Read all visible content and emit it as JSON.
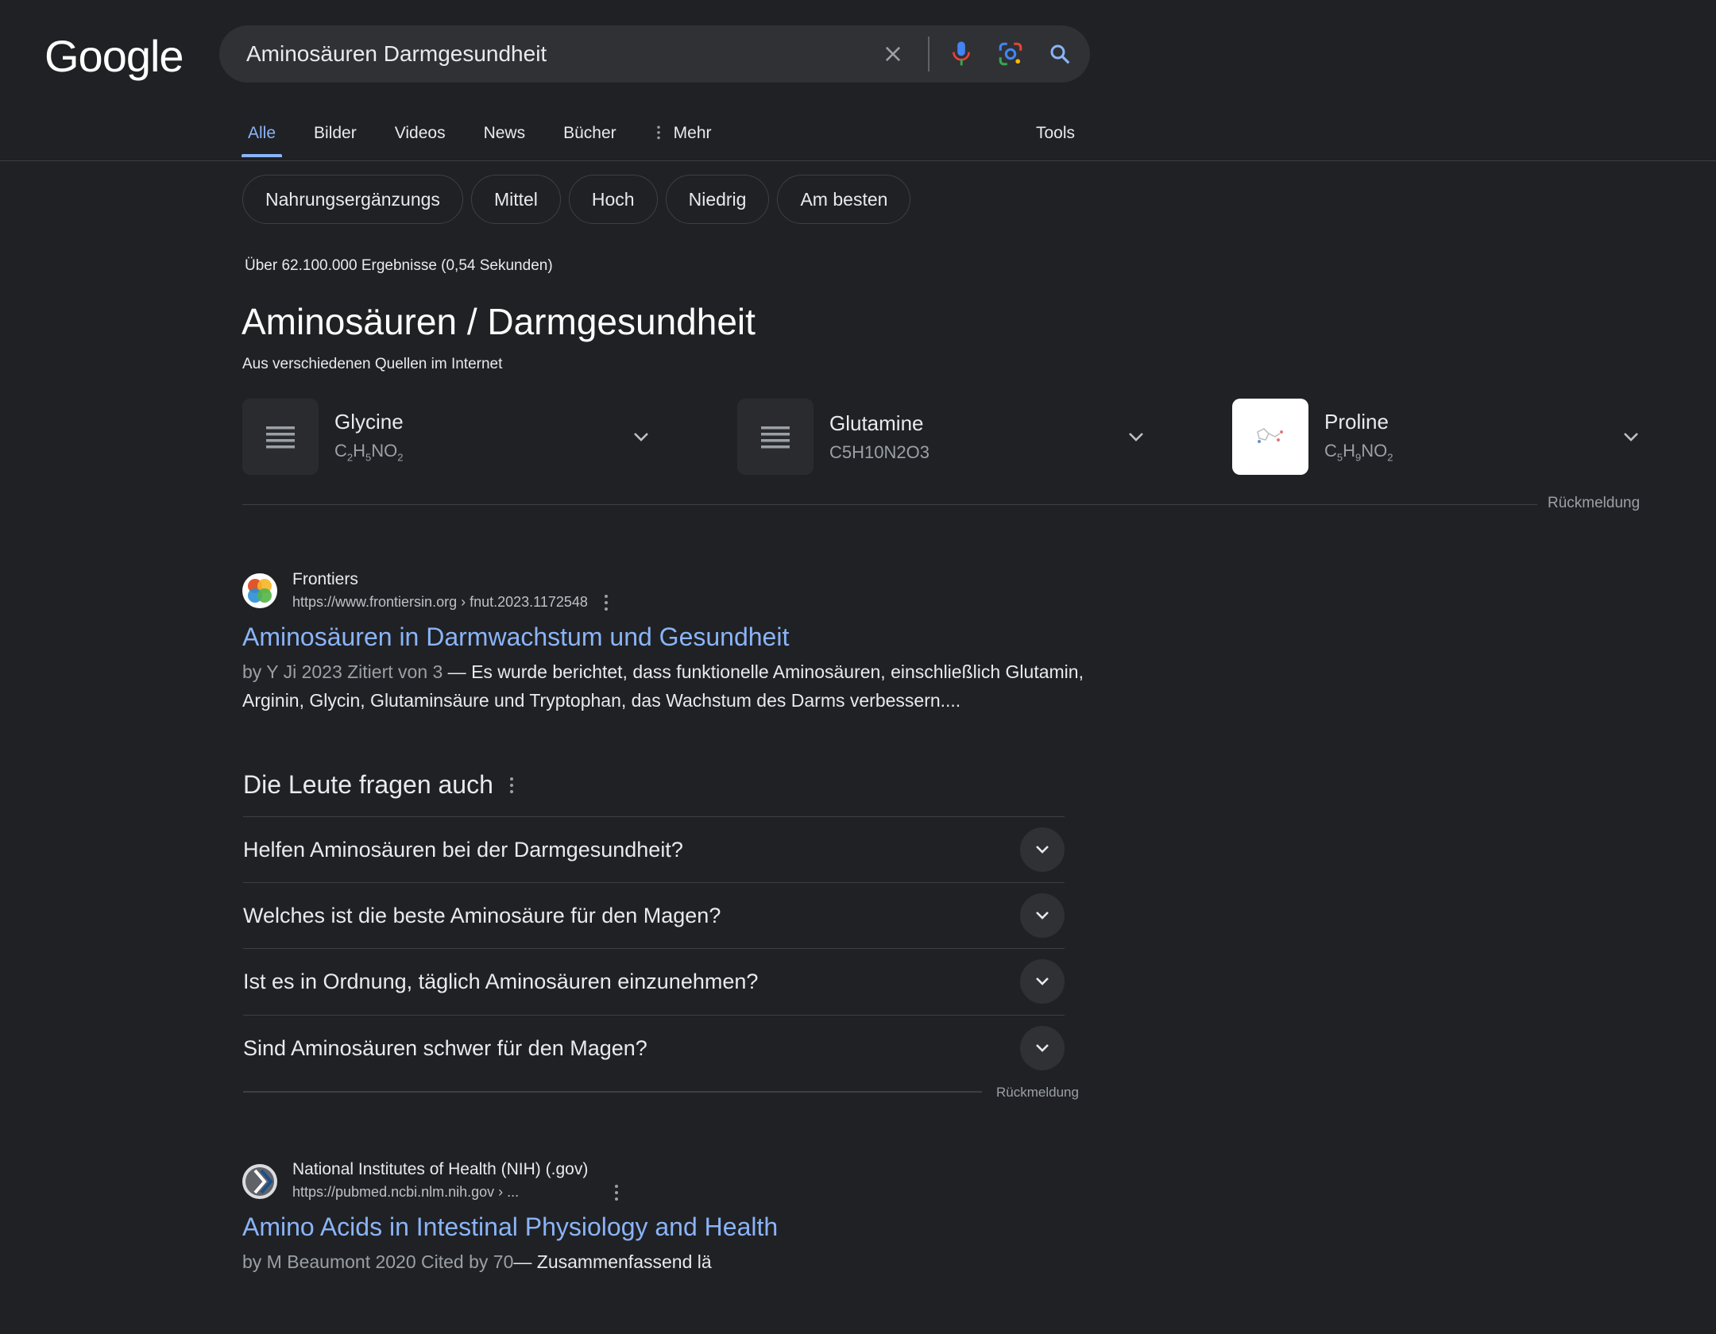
{
  "header": {
    "logo": "Google",
    "search_query": "Aminosäuren Darmgesundheit"
  },
  "tabs": [
    {
      "label": "Alle",
      "active": true
    },
    {
      "label": "Bilder"
    },
    {
      "label": "Videos"
    },
    {
      "label": "News"
    },
    {
      "label": "Bücher"
    },
    {
      "label": "Mehr"
    }
  ],
  "tools_label": "Tools",
  "chips": [
    "Nahrungsergänzungs",
    "Mittel",
    "Hoch",
    "Niedrig",
    "Am besten"
  ],
  "stats": "Über 62.100.000 Ergebnisse (0,54 Sekunden)",
  "knowledge_panel": {
    "title": "Aminosäuren / Darmgesundheit",
    "subtitle": "Aus verschiedenen Quellen im Internet",
    "entities": [
      {
        "name": "Glycine",
        "formula_parts": [
          "C",
          "2",
          "H",
          "5",
          "NO",
          "2"
        ]
      },
      {
        "name": "Glutamine",
        "formula": "C5H10N2O3"
      },
      {
        "name": "Proline",
        "formula_parts": [
          "C",
          "5",
          "H",
          "9",
          "NO",
          "2"
        ]
      }
    ],
    "feedback": "Rückmeldung"
  },
  "results": [
    {
      "site": "Frontiers",
      "url": "https://www.frontiersin.org › fnut.2023.1172548",
      "title": "Aminosäuren in Darmwachstum und Gesundheit",
      "meta": "by Y Ji 2023  Zitiert von 3",
      "snippet": " — Es wurde berichtet, dass funktionelle Aminosäuren, einschließlich Glutamin, Arginin, Glycin, Glutaminsäure und Tryptophan, das Wachstum des Darms verbessern...."
    },
    {
      "site": "National Institutes of Health (NIH) (.gov)",
      "url": "https://pubmed.ncbi.nlm.nih.gov › ...",
      "title": "Amino Acids in Intestinal Physiology and Health",
      "meta": "by M Beaumont 2020 Cited by 70",
      "snippet": "— Zusammenfassend lä"
    }
  ],
  "paa": {
    "heading": "Die Leute fragen auch",
    "questions": [
      "Helfen Aminosäuren bei der Darmgesundheit?",
      "Welches ist die beste Aminosäure für den Magen?",
      "Ist es in Ordnung, täglich Aminosäuren einzunehmen?",
      "Sind Aminosäuren schwer für den Magen?"
    ],
    "feedback": "Rückmeldung"
  },
  "colors": {
    "background": "#202124",
    "link": "#8ab4f8",
    "text": "#e8eaed",
    "muted": "#9aa0a6"
  }
}
